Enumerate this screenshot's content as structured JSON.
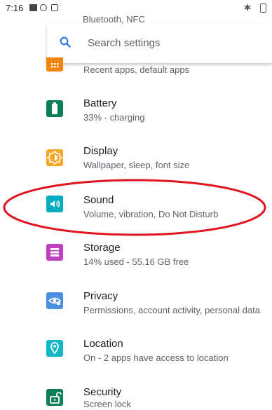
{
  "status_bar": {
    "time": "7:16",
    "icons": [
      "image-icon",
      "circle-icon",
      "square-icon",
      "bluetooth-icon",
      "battery-icon"
    ]
  },
  "partial_top": {
    "subtitle": "Bluetooth, NFC"
  },
  "search": {
    "placeholder": "Search settings"
  },
  "apps_partial": {
    "subtitle": "Recent apps, default apps",
    "icon": "apps-icon",
    "icon_color": "#F4830C"
  },
  "items": [
    {
      "title": "Battery",
      "subtitle": "33% - charging",
      "icon": "battery-icon",
      "color": "#0A7F5A"
    },
    {
      "title": "Display",
      "subtitle": "Wallpaper, sleep, font size",
      "icon": "brightness-icon",
      "color": "#F9A825"
    },
    {
      "title": "Sound",
      "subtitle": "Volume, vibration, Do Not Disturb",
      "icon": "volume-icon",
      "color": "#00ACC1"
    },
    {
      "title": "Storage",
      "subtitle": "14% used - 55.16 GB free",
      "icon": "storage-icon",
      "color": "#BF40BF"
    },
    {
      "title": "Privacy",
      "subtitle": "Permissions, account activity, personal data",
      "icon": "privacy-icon",
      "color": "#4A90E2"
    },
    {
      "title": "Location",
      "subtitle": "On - 2 apps have access to location",
      "icon": "location-icon",
      "color": "#13B8C8"
    },
    {
      "title": "Security",
      "subtitle": "Screen lock",
      "icon": "lock-icon",
      "color": "#0A7F5A"
    }
  ],
  "highlight": {
    "target": "Sound",
    "color": "#E2131E"
  }
}
